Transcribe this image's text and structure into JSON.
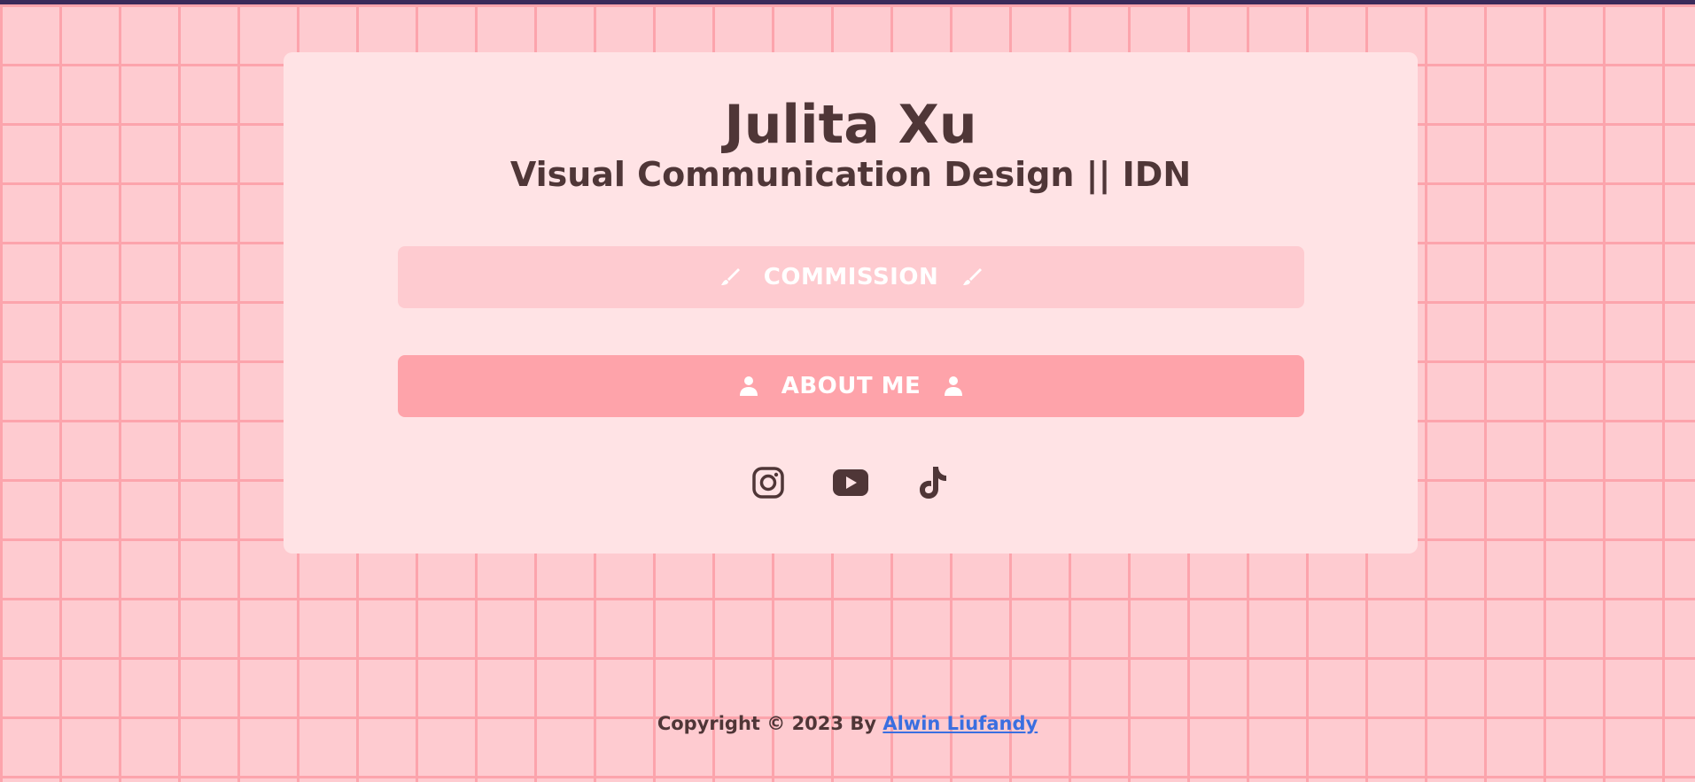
{
  "profile": {
    "name": "Julita Xu",
    "tagline": "Visual Communication Design || IDN"
  },
  "buttons": {
    "commission": {
      "label": "COMMISSION",
      "icon": "paintbrush-icon"
    },
    "about": {
      "label": "ABOUT ME",
      "icon": "user-icon"
    }
  },
  "social": [
    {
      "name": "instagram-icon"
    },
    {
      "name": "youtube-icon"
    },
    {
      "name": "tiktok-icon"
    }
  ],
  "footer": {
    "prefix": "Copyright © 2023 By ",
    "author": "Alwin Liufandy"
  },
  "colors": {
    "background": "#fecbd0",
    "grid": "#fca4ac",
    "card": "#ffe3e5",
    "text": "#4f3637",
    "button_light": "#fecbd0",
    "button_strong": "#fea3aa",
    "link": "#3a6fe0"
  }
}
